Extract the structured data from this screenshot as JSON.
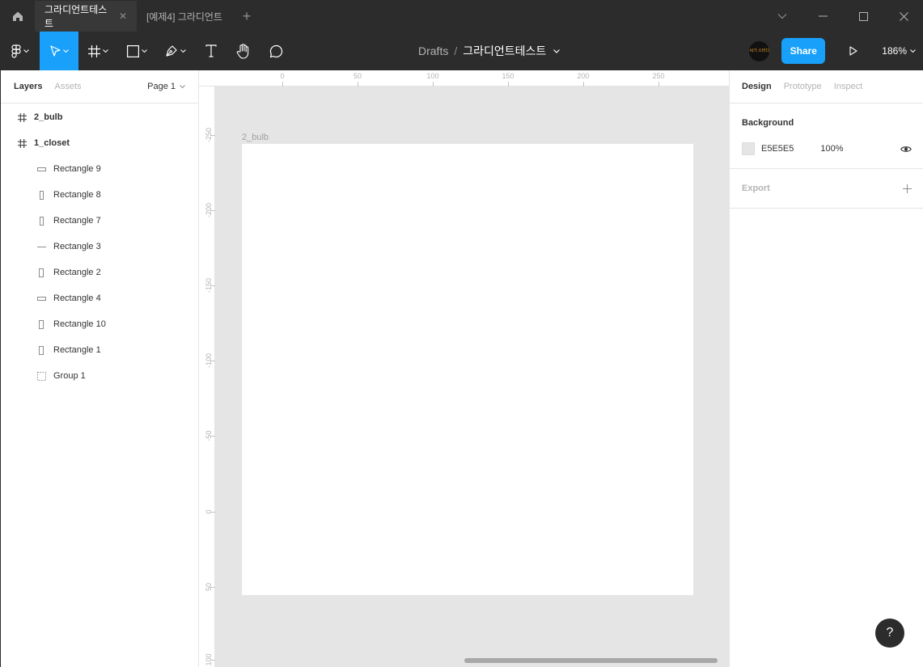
{
  "titlebar": {
    "tabs": [
      {
        "label": "그라디언트테스트",
        "close": "✕"
      },
      {
        "label": "[예제4] 그라디언트"
      }
    ],
    "new_tab": "+"
  },
  "toolbar": {
    "breadcrumb_drafts": "Drafts",
    "breadcrumb_sep": "/",
    "file_name": "그라디언트테스트",
    "avatar_text": "씨기 스터디",
    "share_label": "Share",
    "zoom_label": "186%"
  },
  "left_panel": {
    "tabs": [
      "Layers",
      "Assets"
    ],
    "page_label": "Page 1",
    "layers": [
      {
        "name": "2_bulb",
        "type": "frame"
      },
      {
        "name": "1_closet",
        "type": "frame"
      },
      {
        "name": "Rectangle 9",
        "type": "rect-h"
      },
      {
        "name": "Rectangle 8",
        "type": "rect-v"
      },
      {
        "name": "Rectangle 7",
        "type": "rect-v"
      },
      {
        "name": "Rectangle 3",
        "type": "line"
      },
      {
        "name": "Rectangle 2",
        "type": "rect-v"
      },
      {
        "name": "Rectangle 4",
        "type": "rect-h"
      },
      {
        "name": "Rectangle 10",
        "type": "rect-v"
      },
      {
        "name": "Rectangle 1",
        "type": "rect-v"
      },
      {
        "name": "Group 1",
        "type": "group"
      }
    ]
  },
  "rulers": {
    "top": [
      "0",
      "50",
      "100",
      "150",
      "200",
      "250"
    ],
    "left": [
      "-250",
      "-200",
      "-150",
      "-100",
      "-50",
      "0",
      "50",
      "100"
    ]
  },
  "canvas": {
    "frame_label": "2_bulb",
    "frame_color": "#ffffff",
    "background_color": "#e5e5e5"
  },
  "right_panel": {
    "tabs": [
      "Design",
      "Prototype",
      "Inspect"
    ],
    "background_title": "Background",
    "background_hex": "E5E5E5",
    "background_opacity": "100%",
    "export_title": "Export",
    "help_label": "?"
  },
  "colors": {
    "accent": "#18a0fb",
    "chrome": "#2c2c2c"
  }
}
